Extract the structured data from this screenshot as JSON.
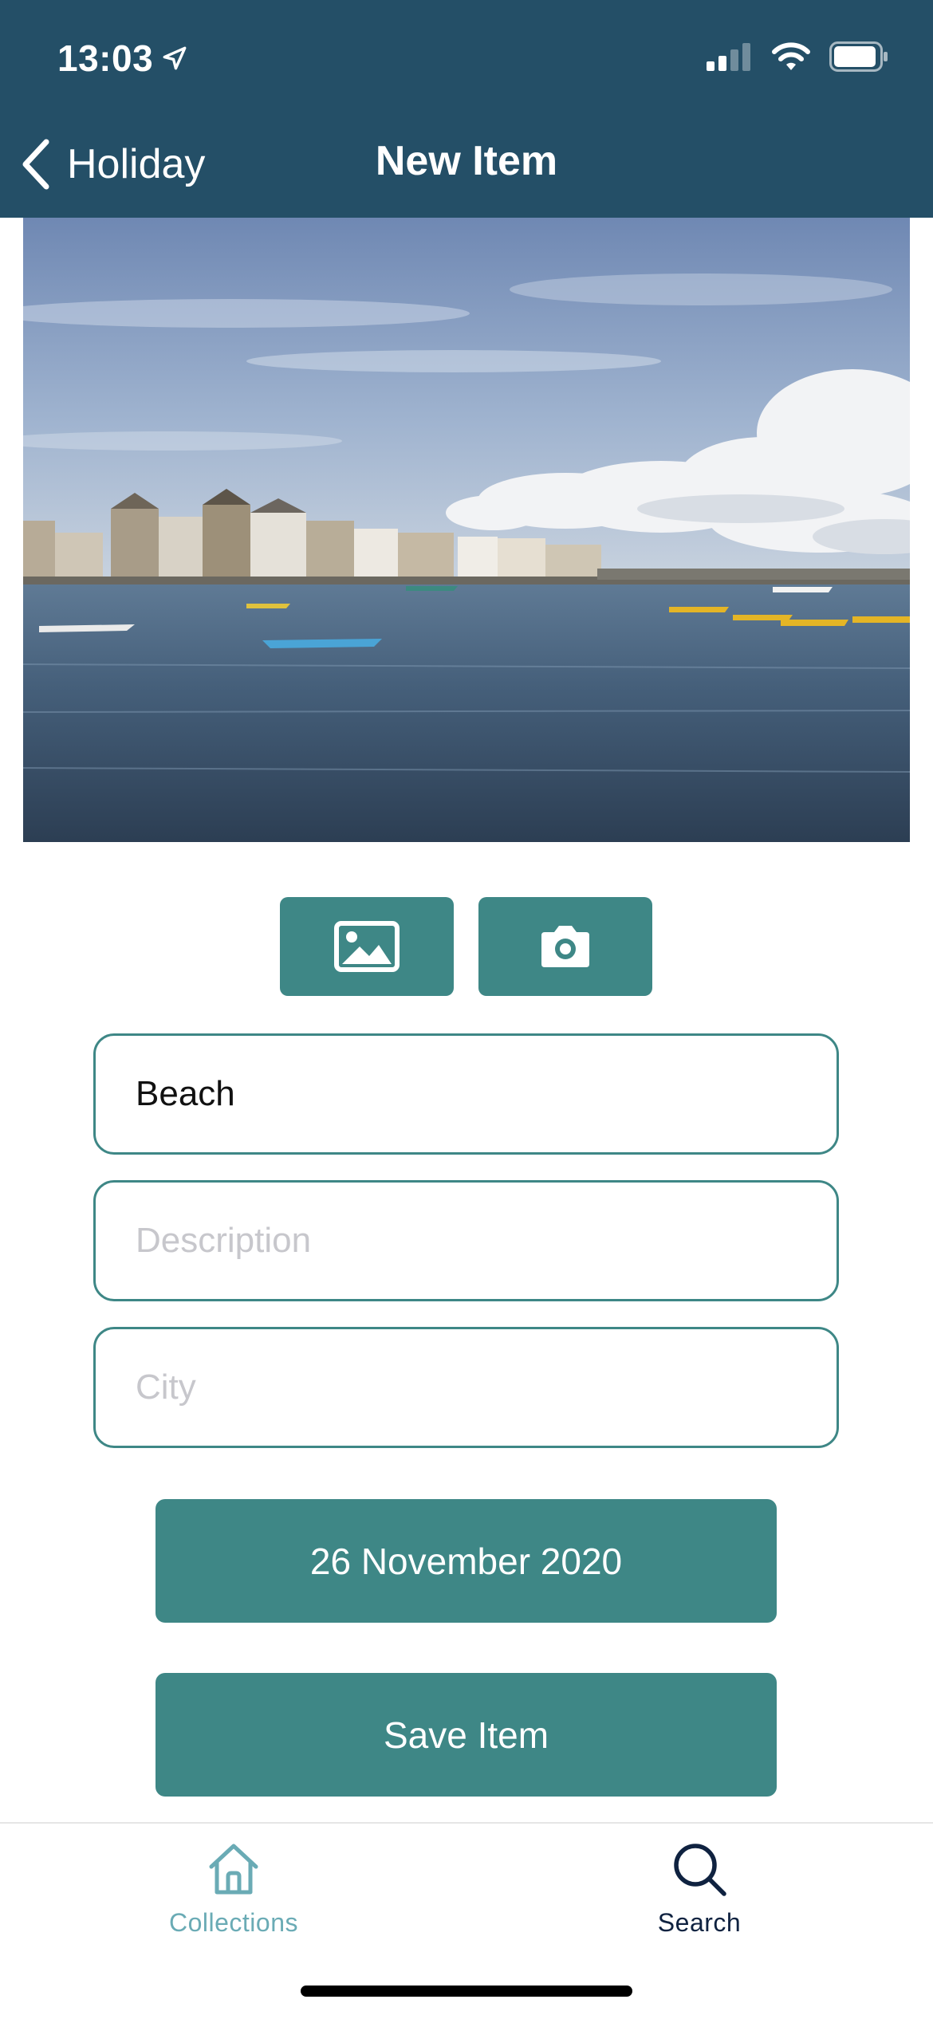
{
  "status_bar": {
    "time": "13:03",
    "location_icon": "location-arrow-icon",
    "signal_icon": "cellular-signal-icon",
    "wifi_icon": "wifi-icon",
    "battery_icon": "battery-icon"
  },
  "nav": {
    "back_label": "Holiday",
    "back_icon": "chevron-left-icon",
    "title": "New Item"
  },
  "photo": {
    "icon": "harbour-photo"
  },
  "image_actions": {
    "gallery_icon": "image-gallery-icon",
    "camera_icon": "camera-icon"
  },
  "form": {
    "title_value": "Beach",
    "title_placeholder": "",
    "description_value": "",
    "description_placeholder": "Description",
    "city_value": "",
    "city_placeholder": "City"
  },
  "date_button": "26 November 2020",
  "save_button": "Save Item",
  "tabbar": {
    "items": [
      {
        "label": "Collections",
        "icon": "home-icon",
        "active": false
      },
      {
        "label": "Search",
        "icon": "search-icon",
        "active": true
      }
    ]
  },
  "colors": {
    "header_bg": "#244f67",
    "accent": "#3e8786",
    "tab_inactive": "#6aabb5",
    "tab_active": "#0f2240",
    "placeholder": "#c7c7cc"
  }
}
